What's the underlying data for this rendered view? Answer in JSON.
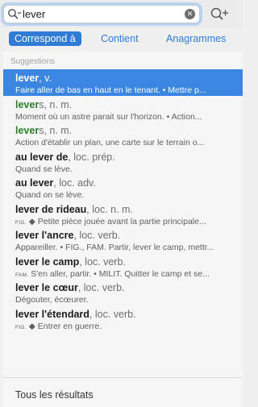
{
  "search": {
    "query": "lever",
    "clear_glyph": "✕",
    "icons": [
      "search-icon",
      "add-word-icon"
    ]
  },
  "tabs": [
    {
      "label": "Correspond à",
      "active": true
    },
    {
      "label": "Contient",
      "active": false
    },
    {
      "label": "Anagrammes",
      "active": false
    }
  ],
  "section_label": "Suggestions",
  "results": [
    {
      "word": "lever",
      "stem": "",
      "suffix": "",
      "gram": ", v.",
      "tag": "",
      "def": "Faire aller de bas en haut en le tenant. • Mettre p...",
      "selected": true
    },
    {
      "word": "",
      "stem": "lever",
      "suffix": "s",
      "gram": ", n. m.",
      "tag": "",
      "def": "Moment où un astre parait sur l'horizon. • Action...",
      "selected": false
    },
    {
      "word": "",
      "stem": "lever",
      "suffix": "s",
      "gram": ", n. m.",
      "tag": "",
      "def": "Action d'établir un plan, une carte sur le terrain o...",
      "selected": false
    },
    {
      "word": "au lever de",
      "stem": "",
      "suffix": "",
      "gram": ", loc. prép.",
      "tag": "",
      "def": "Quand se lève.",
      "selected": false
    },
    {
      "word": "au lever",
      "stem": "",
      "suffix": "",
      "gram": ", loc. adv.",
      "tag": "",
      "def": "Quand on se lève.",
      "selected": false
    },
    {
      "word": "lever de rideau",
      "stem": "",
      "suffix": "",
      "gram": ", loc. n. m.",
      "tag": "FIG.",
      "def": "◆ Petite pièce jouée avant la partie principale...",
      "selected": false
    },
    {
      "word": "lever l'ancre",
      "stem": "",
      "suffix": "",
      "gram": ", loc. verb.",
      "tag": "",
      "def": "Appareiller. • FIG., FAM. Partir, lever le camp, mettr...",
      "selected": false
    },
    {
      "word": "lever le camp",
      "stem": "",
      "suffix": "",
      "gram": ", loc. verb.",
      "tag": "FAM.",
      "def": "S'en aller, partir. • MILIT. Quitter le camp et se...",
      "selected": false
    },
    {
      "word": "lever le cœur",
      "stem": "",
      "suffix": "",
      "gram": ", loc. verb.",
      "tag": "",
      "def": "Dégouter, écœurer.",
      "selected": false
    },
    {
      "word": "lever l'étendard",
      "stem": "",
      "suffix": "",
      "gram": ", loc. verb.",
      "tag": "FIG.",
      "def": "◆ Entrer en guerre.",
      "selected": false
    }
  ],
  "footer_label": "Tous les résultats"
}
